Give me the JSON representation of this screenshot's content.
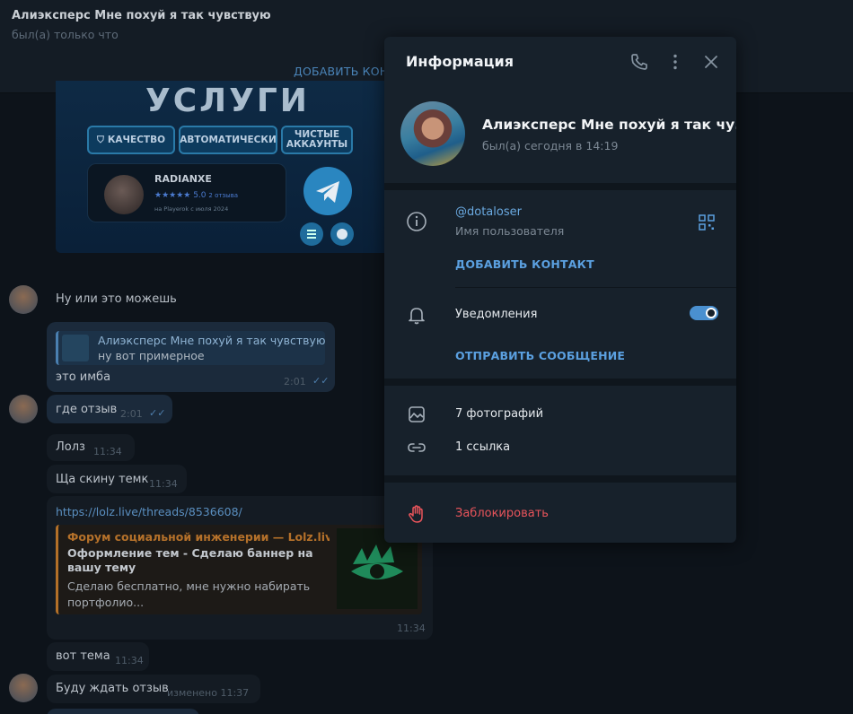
{
  "chat": {
    "title": "Алиэксперс Мне похуй я так чувствую",
    "status": "был(а) только что",
    "add_contact": "ДОБАВИТЬ КОНТАКТ",
    "banner": {
      "title": "УСЛУГИ",
      "tags": [
        "КАЧЕСТВО",
        "АВТОМАТИЧЕСКИ",
        "ЧИСТЫЕ АККАУНТЫ"
      ],
      "card_name": "RADIANXE",
      "card_rating": "★★★★★ 5.0",
      "card_reviews": "2 отзыва",
      "card_since": "на Playerok с июля 2024"
    },
    "messages": [
      {
        "text": "Ну или это можешь"
      },
      {
        "reply_name": "Алиэксперс Мне похуй я так чувствую",
        "reply_text": "ну вот примерное",
        "text": "это имба",
        "time": "2:01"
      },
      {
        "text": "где отзыв",
        "time": "2:01"
      },
      {
        "text": "Лолз",
        "time": "11:34"
      },
      {
        "text": "Ща скину темк",
        "time": "11:34"
      },
      {
        "link": "https://lolz.live/threads/8536608/",
        "time": "11:34"
      },
      {
        "text": "вот тема",
        "time": "11:34"
      },
      {
        "text": "Буду ждать отзыв",
        "time": "изменено 11:37"
      }
    ],
    "link_preview": {
      "site": "Форум социальной инженерии — Lolz.live...",
      "title": "Оформление тем - Сделаю баннер на вашу тему",
      "desc": "Сделаю бесплатно, мне нужно набирать портфолио..."
    }
  },
  "panel": {
    "title": "Информация",
    "name": "Алиэксперс Мне похуй я так чу...",
    "seen": "был(а) сегодня в 14:19",
    "username": "@dotaloser",
    "username_label": "Имя пользователя",
    "add_contact": "ДОБАВИТЬ КОНТАКТ",
    "notifications": "Уведомления",
    "notifications_on": true,
    "send_message": "ОТПРАВИТЬ СООБЩЕНИЕ",
    "photos": "7 фотографий",
    "links": "1 ссылка",
    "block": "Заблокировать",
    "icons": [
      "phone-icon",
      "more-vertical-icon",
      "close-icon",
      "info-icon",
      "qr-code-icon",
      "bell-icon",
      "photo-icon",
      "link-icon",
      "block-hand-icon"
    ],
    "colors": {
      "accent": "#5ba0e0",
      "danger": "#e8545b",
      "panel_bg": "#17212b"
    }
  }
}
